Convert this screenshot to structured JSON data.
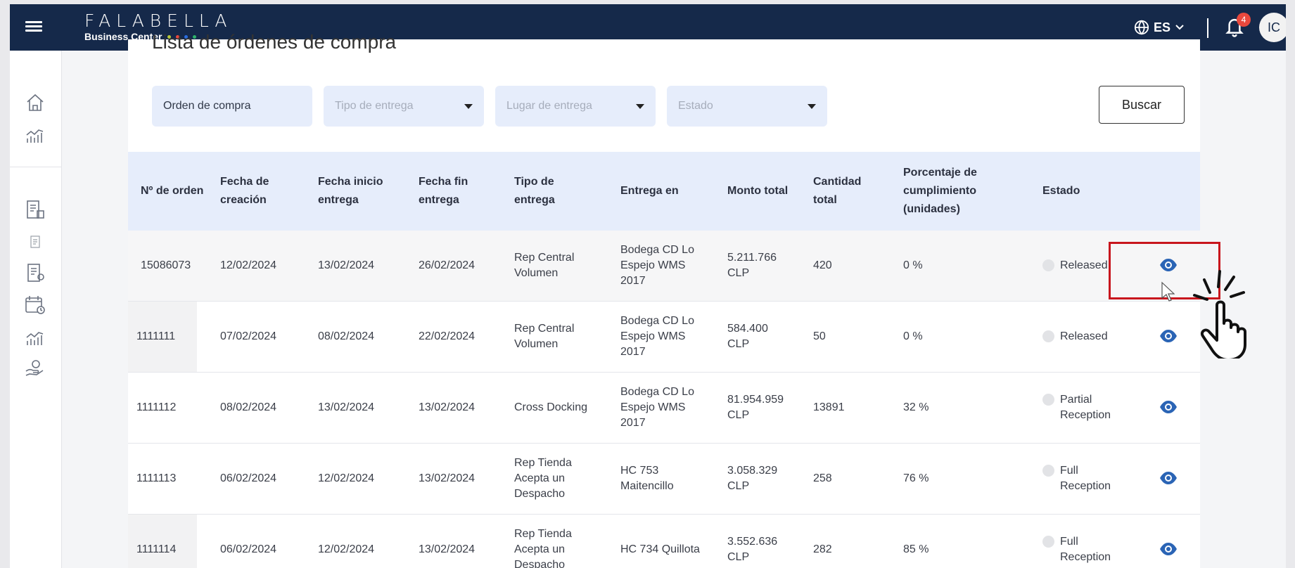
{
  "header": {
    "brand_name": "FALABELLA",
    "brand_sub": "Business Center",
    "brand_dot_colors": [
      "#b7c83a",
      "#e8483d",
      "#2a6de0",
      "#2eb36b"
    ],
    "language": "ES",
    "notification_count": "4",
    "avatar_initials": "IC",
    "bg_color": "#15294a"
  },
  "sidebar": {
    "items": [
      "home-icon",
      "analytics-icon",
      "invoice-icon",
      "document-icon",
      "order-list-icon",
      "calendar-icon",
      "analytics-2-icon",
      "hand-coin-icon"
    ]
  },
  "page": {
    "title": "Lista de órdenes de compra"
  },
  "filters": {
    "orden": "Orden de compra",
    "tipo": "Tipo de entrega",
    "lugar": "Lugar de entrega",
    "estado": "Estado",
    "buscar": "Buscar"
  },
  "table": {
    "headers": {
      "orden": "Nº de orden",
      "creacion": "Fecha de creación",
      "inicio": "Fecha inicio entrega",
      "fin": "Fecha fin entrega",
      "tipo": "Tipo de entrega",
      "entrega": "Entrega en",
      "monto": "Monto total",
      "cantidad": "Cantidad total",
      "porcentaje": "Porcentaje de cumplimiento (unidades)",
      "estado": "Estado"
    },
    "rows": [
      {
        "orden": "15086073",
        "creacion": "12/02/2024",
        "inicio": "13/02/2024",
        "fin": "26/02/2024",
        "tipo": "Rep Central Volumen",
        "entrega": "Bodega CD Lo Espejo WMS 2017",
        "monto": "5.211.766 CLP",
        "cantidad": "420",
        "porcentaje": "0 %",
        "estado": "Released"
      },
      {
        "orden": "1111111",
        "creacion": "07/02/2024",
        "inicio": "08/02/2024",
        "fin": "22/02/2024",
        "tipo": "Rep Central Volumen",
        "entrega": "Bodega CD Lo Espejo WMS 2017",
        "monto": "584.400 CLP",
        "cantidad": "50",
        "porcentaje": "0 %",
        "estado": "Released"
      },
      {
        "orden": "1111112",
        "creacion": "08/02/2024",
        "inicio": "13/02/2024",
        "fin": "13/02/2024",
        "tipo": "Cross Docking",
        "entrega": "Bodega CD Lo Espejo WMS 2017",
        "monto": "81.954.959 CLP",
        "cantidad": "13891",
        "porcentaje": "32 %",
        "estado": "Partial Reception"
      },
      {
        "orden": "1111113",
        "creacion": "06/02/2024",
        "inicio": "12/02/2024",
        "fin": "13/02/2024",
        "tipo": "Rep Tienda Acepta un Despacho",
        "entrega": "HC 753 Maitencillo",
        "monto": "3.058.329 CLP",
        "cantidad": "258",
        "porcentaje": "76 %",
        "estado": "Full Reception"
      },
      {
        "orden": "1111114",
        "creacion": "06/02/2024",
        "inicio": "12/02/2024",
        "fin": "13/02/2024",
        "tipo": "Rep Tienda Acepta un Despacho",
        "entrega": "HC 734 Quillota",
        "monto": "3.552.636 CLP",
        "cantidad": "282",
        "porcentaje": "85 %",
        "estado": "Full Reception"
      }
    ]
  },
  "colors": {
    "accent": "#2a64b5",
    "highlight": "#c8161d",
    "header_row": "#e6edfb"
  }
}
